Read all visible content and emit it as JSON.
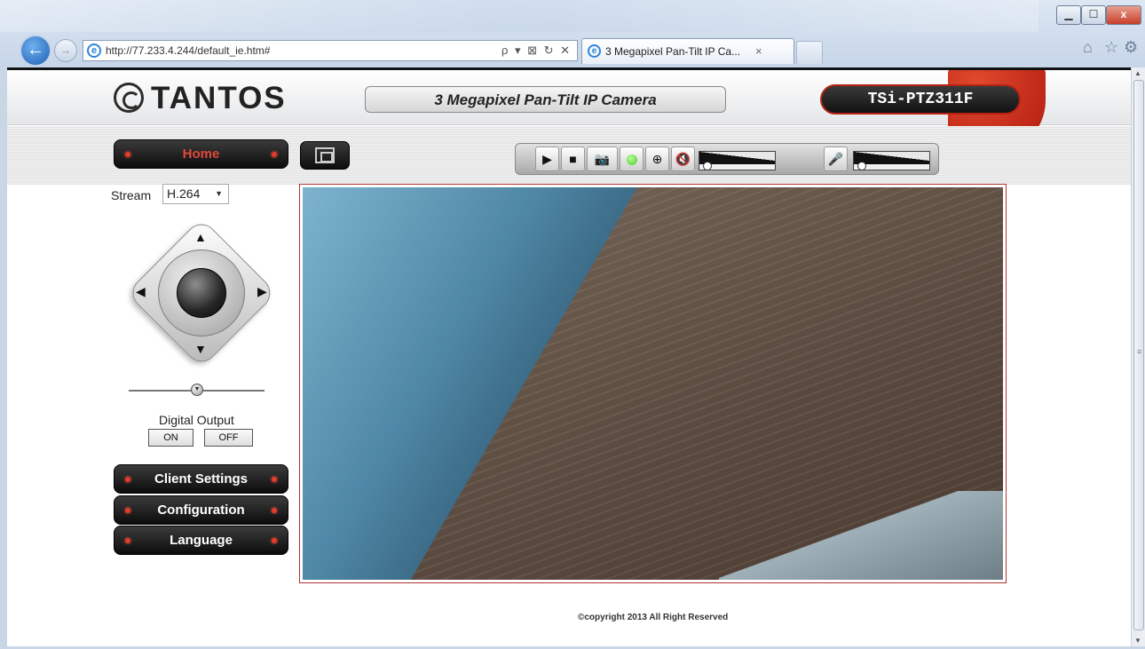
{
  "browser": {
    "url": "http://77.233.4.244/default_ie.htm#",
    "tab_title": "3 Megapixel Pan-Tilt IP Ca...",
    "tab_close": "×",
    "address_tools": "ρ ▾ ⊠ ↻ ✕",
    "window_buttons": {
      "minimize": "▁",
      "maximize": "☐",
      "close": "x"
    }
  },
  "header": {
    "logo_text": "TANTOS",
    "model_title": "3 Megapixel Pan-Tilt IP Camera",
    "model_code": "TSi-PTZ311F"
  },
  "nav": {
    "home": "Home",
    "client_settings": "Client Settings",
    "configuration": "Configuration",
    "language": "Language"
  },
  "stream": {
    "label": "Stream",
    "selected": "H.264"
  },
  "digital_output": {
    "label": "Digital Output",
    "on": "ON",
    "off": "OFF"
  },
  "toolbar": {
    "icons": [
      "play-icon",
      "stop-icon",
      "camera-icon",
      "status-led-icon",
      "zoom-in-icon",
      "speaker-mute-icon",
      "mic-mute-icon"
    ],
    "speaker_volume": 0.05,
    "mic_volume": 0.05,
    "status_color": "#48c72a"
  },
  "ptz": {
    "speed": 0.5
  },
  "footer": {
    "copyright": "©copyright 2013 All Right Reserved"
  },
  "colors": {
    "accent_red": "#b1190f",
    "button_dark": "#121212",
    "home_label": "#e0473a"
  }
}
